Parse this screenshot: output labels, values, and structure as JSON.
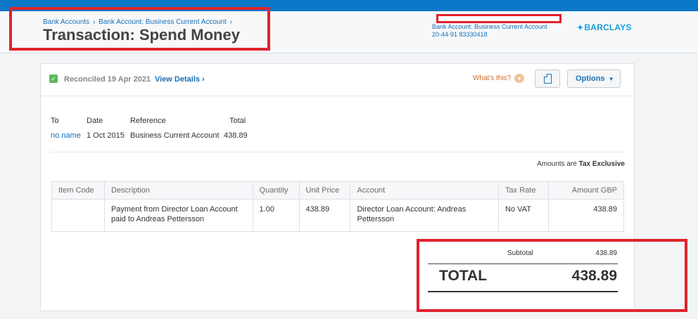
{
  "header": {
    "breadcrumb": [
      "Bank Accounts",
      "Bank Account: Business Current Account"
    ],
    "breadcrumb_sep": "›",
    "title": "Transaction: Spend Money",
    "account_line1": "Bank Account: Business Current Account",
    "account_line2": "20-44-91 83330418",
    "bank_logo": "BARCLAYS",
    "bank_logo_icon": "eagle-icon"
  },
  "status": {
    "reconciled": "Reconciled 19 Apr 2021",
    "view_details": "View Details ›",
    "whats_this": "What's this?",
    "options": "Options",
    "copy_icon": "copy-icon"
  },
  "summary": {
    "headers": [
      "To",
      "Date",
      "Reference",
      "Total"
    ],
    "values": [
      "no name",
      "1 Oct 2015",
      "Business Current Account",
      "438.89"
    ]
  },
  "tax_mode": {
    "prefix": "Amounts are ",
    "value": "Tax Exclusive"
  },
  "line_items": {
    "columns": [
      "Item Code",
      "Description",
      "Quantity",
      "Unit Price",
      "Account",
      "Tax Rate",
      "Amount GBP"
    ],
    "rows": [
      [
        "",
        "Payment from Director Loan Account paid to Andreas Pettersson",
        "1.00",
        "438.89",
        "Director Loan Account: Andreas Pettersson",
        "No VAT",
        "438.89"
      ]
    ]
  },
  "totals": {
    "subtotal_label": "Subtotal",
    "subtotal_value": "438.89",
    "total_label": "TOTAL",
    "total_value": "438.89"
  },
  "colors": {
    "accent": "#0b78c8",
    "link": "#1a6fb5",
    "highlight_box": "#e0232c",
    "reconciled_check": "#5cb85c"
  }
}
